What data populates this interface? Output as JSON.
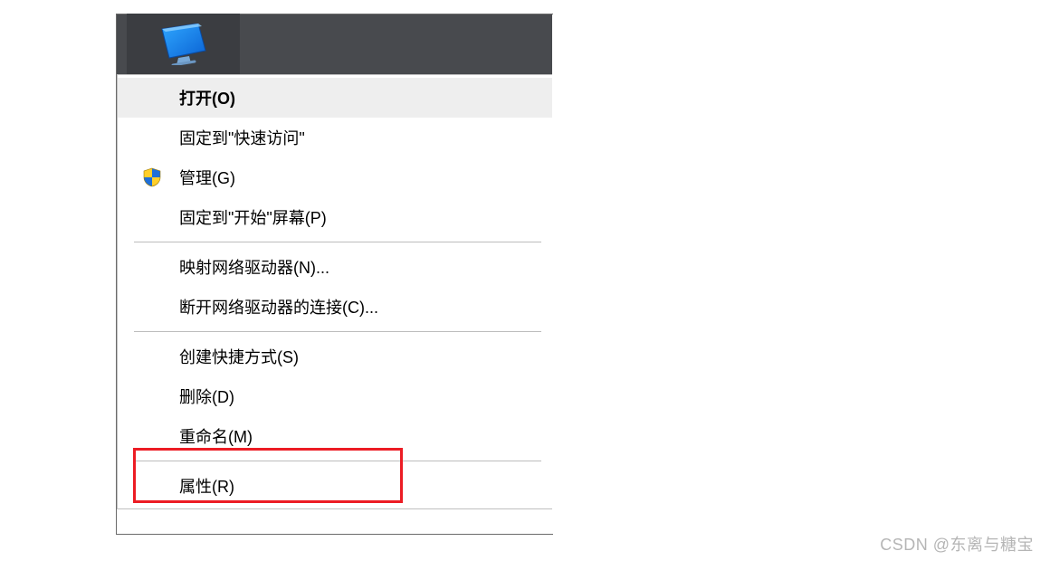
{
  "taskbar": {
    "icon": "this-pc-monitor-icon"
  },
  "context_menu": {
    "items": [
      {
        "label": "打开(O)",
        "default": true,
        "icon": null
      },
      {
        "label": "固定到\"快速访问\"",
        "default": false,
        "icon": null
      },
      {
        "label": "管理(G)",
        "default": false,
        "icon": "shield-uac-icon"
      },
      {
        "label": "固定到\"开始\"屏幕(P)",
        "default": false,
        "icon": null
      }
    ],
    "items2": [
      {
        "label": "映射网络驱动器(N)...",
        "default": false,
        "icon": null
      },
      {
        "label": "断开网络驱动器的连接(C)...",
        "default": false,
        "icon": null
      }
    ],
    "items3": [
      {
        "label": "创建快捷方式(S)",
        "default": false,
        "icon": null
      },
      {
        "label": "删除(D)",
        "default": false,
        "icon": null
      },
      {
        "label": "重命名(M)",
        "default": false,
        "icon": null
      }
    ],
    "items4": [
      {
        "label": "属性(R)",
        "default": false,
        "icon": null,
        "highlighted": true
      }
    ]
  },
  "watermarks": {
    "w1": "CSDN @东离与糖宝"
  }
}
